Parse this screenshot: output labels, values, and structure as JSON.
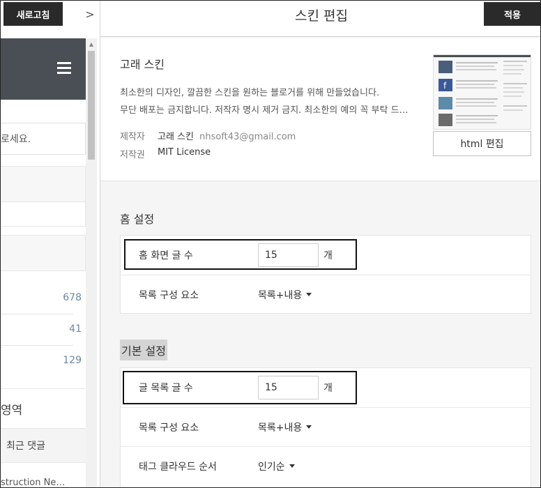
{
  "toolbar": {
    "refresh_label": "새로고침",
    "collapse_icon": "chevron-right-icon",
    "collapse_glyph": ">",
    "apply_label": "적용"
  },
  "preview": {
    "search_placeholder_fragment": "로세요.",
    "counts": [
      "678",
      "41",
      "129"
    ],
    "area_label": "영역",
    "recent_comments": "최근 댓글",
    "bottom_text": "struction Ne…"
  },
  "editor": {
    "title": "스킨 편집",
    "skin": {
      "name": "고래 스킨",
      "desc_line1": "최소한의 디자인, 깔끔한 스킨을 원하는 블로거를 위해 만들었습니다.",
      "desc_line2": "무단 배포는 금지합니다. 저작자 명시 제거 금지. 최소한의 예의 꼭 부탁 드…",
      "author_label": "제작자",
      "author_name": "고래 스킨",
      "author_email": "nhsoft43@gmail.com",
      "license_label": "저작권",
      "license_value": "MIT License",
      "html_edit_label": "html 편집"
    },
    "home_settings": {
      "title": "홈 설정",
      "post_count_label": "홈 화면 글 수",
      "post_count_value": "15",
      "unit": "개",
      "list_component_label": "목록 구성 요소",
      "list_component_value": "목록+내용"
    },
    "basic_settings": {
      "title": "기본 설정",
      "list_count_label": "글 목록 글 수",
      "list_count_value": "15",
      "unit": "개",
      "list_component_label": "목록 구성 요소",
      "list_component_value": "목록+내용",
      "tag_cloud_label": "태그 클라우드 순서",
      "tag_cloud_value": "인기순"
    }
  },
  "colors": {
    "dark_button": "#2a2a2a",
    "preview_header": "#4a4f55",
    "count_text": "#6a87a5",
    "section_highlight": "#d4d4d4"
  }
}
